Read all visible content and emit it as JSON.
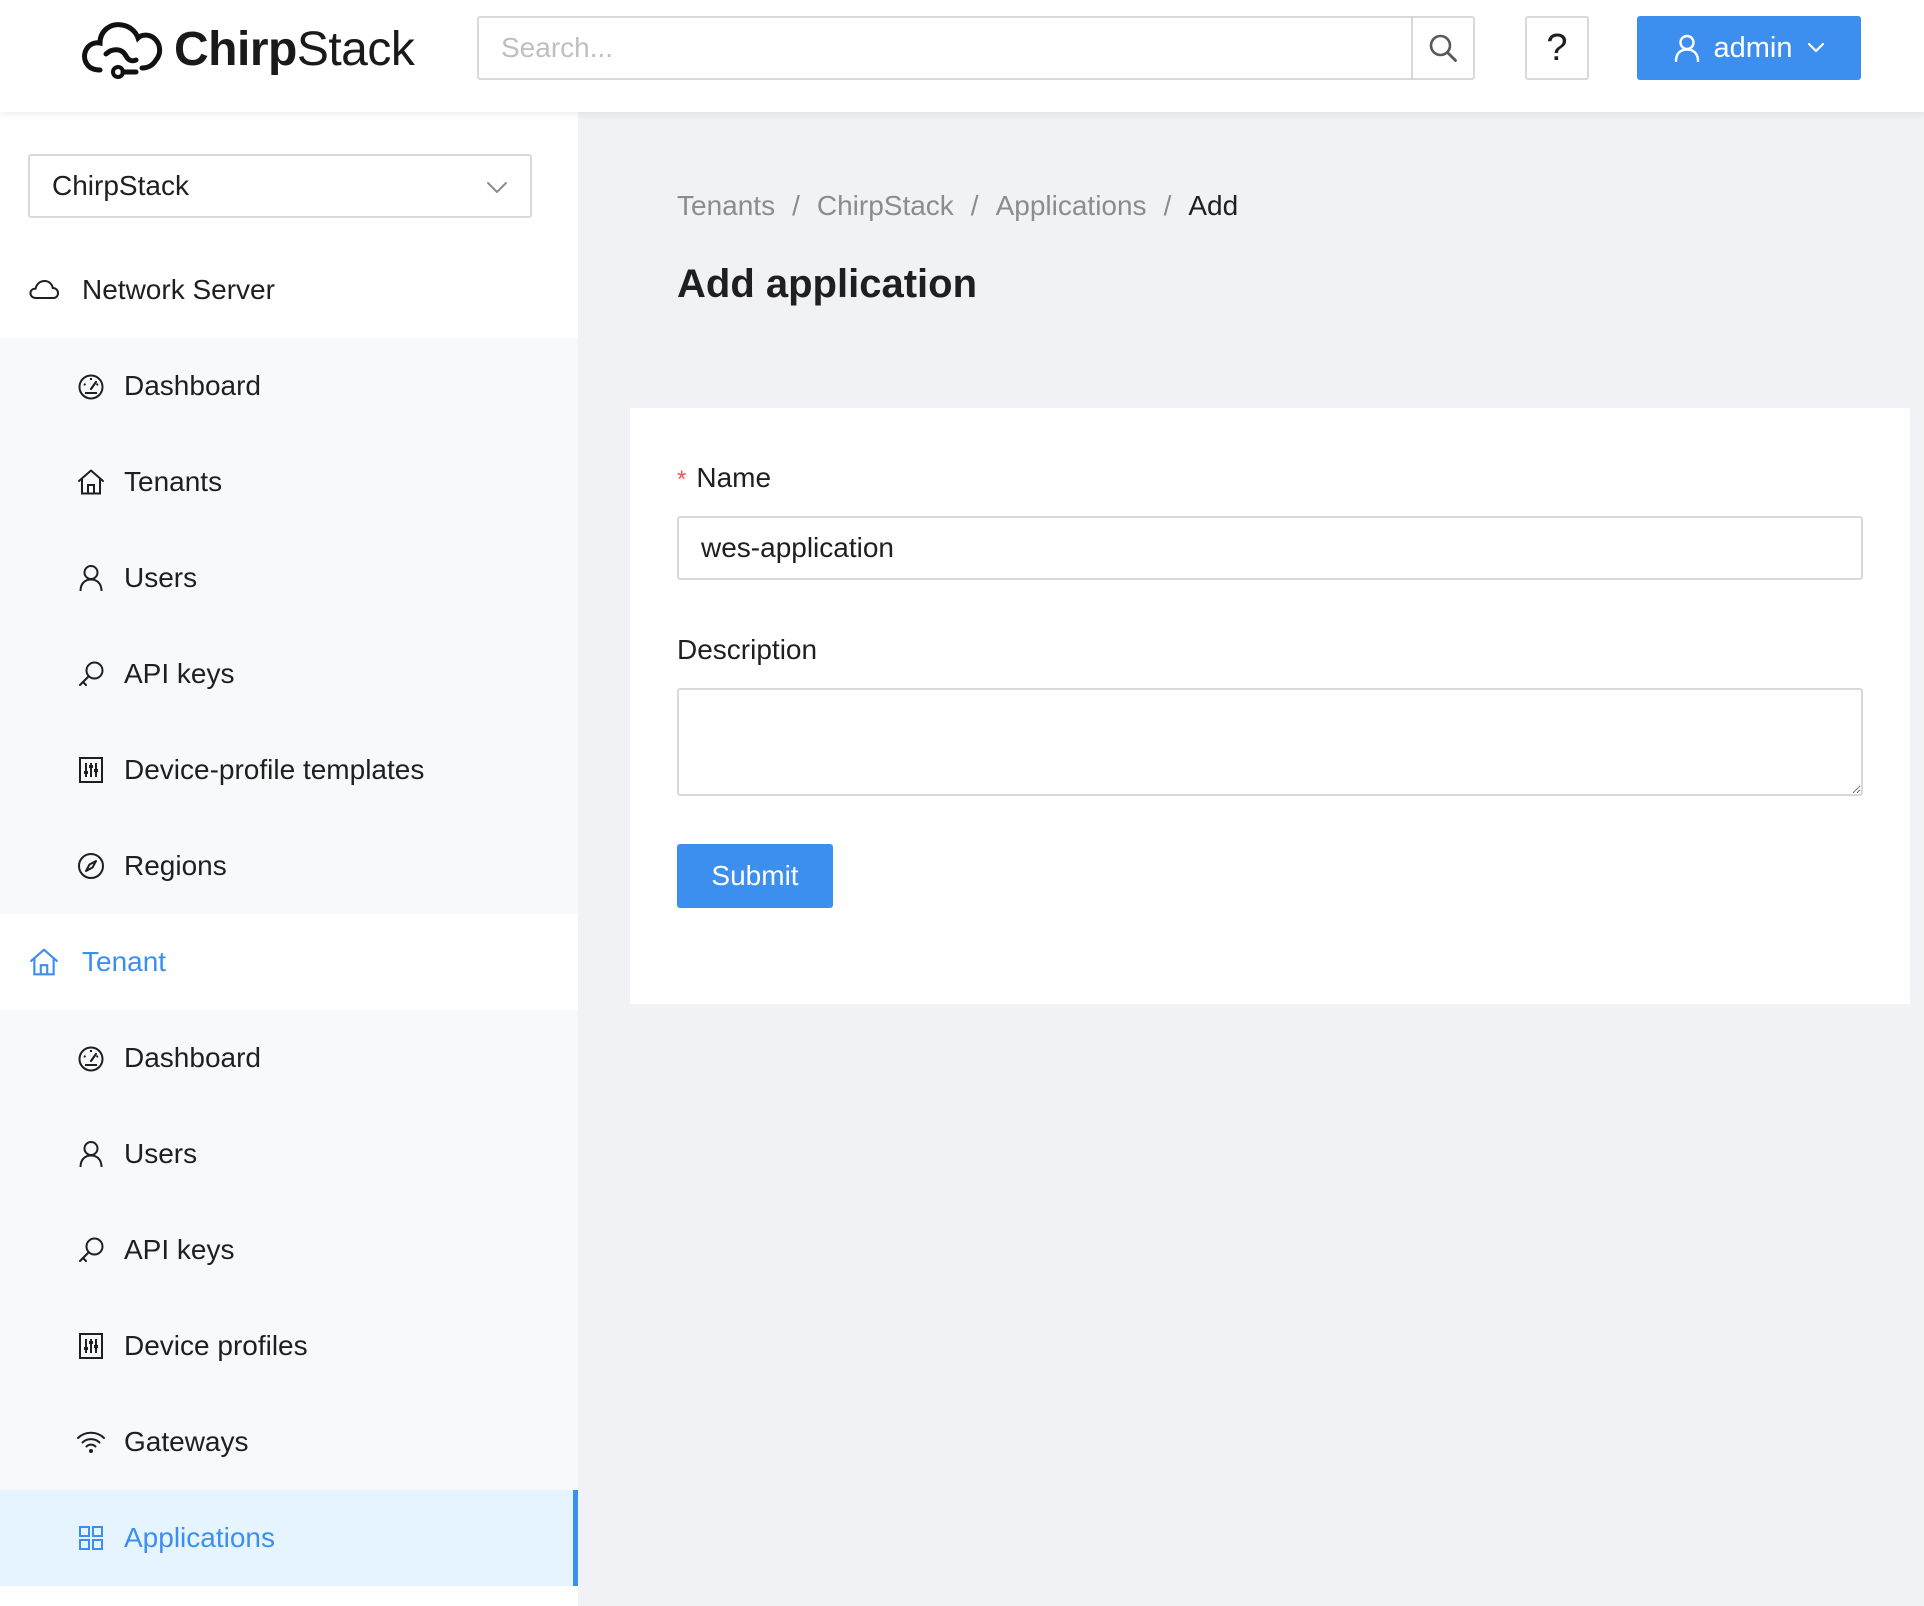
{
  "header": {
    "logo_text_bold": "Chirp",
    "logo_text_rest": "Stack",
    "search_placeholder": "Search...",
    "help_label": "?",
    "user_label": "admin"
  },
  "sidebar": {
    "tenant_select_value": "ChirpStack",
    "groups": [
      {
        "title": "Network Server",
        "icon": "cloud-icon",
        "items": [
          {
            "label": "Dashboard",
            "icon": "dashboard-icon"
          },
          {
            "label": "Tenants",
            "icon": "home-icon"
          },
          {
            "label": "Users",
            "icon": "user-icon"
          },
          {
            "label": "API keys",
            "icon": "key-icon"
          },
          {
            "label": "Device-profile templates",
            "icon": "control-icon"
          },
          {
            "label": "Regions",
            "icon": "compass-icon"
          }
        ]
      },
      {
        "title": "Tenant",
        "icon": "home-icon",
        "items": [
          {
            "label": "Dashboard",
            "icon": "dashboard-icon"
          },
          {
            "label": "Users",
            "icon": "user-icon"
          },
          {
            "label": "API keys",
            "icon": "key-icon"
          },
          {
            "label": "Device profiles",
            "icon": "control-icon"
          },
          {
            "label": "Gateways",
            "icon": "wifi-icon"
          },
          {
            "label": "Applications",
            "icon": "appstore-icon"
          }
        ]
      }
    ]
  },
  "breadcrumb": [
    "Tenants",
    "ChirpStack",
    "Applications",
    "Add"
  ],
  "page_title": "Add application",
  "form": {
    "name_label": "Name",
    "name_required_mark": "*",
    "name_value": "wes-application",
    "description_label": "Description",
    "description_value": "",
    "submit_label": "Submit"
  },
  "colors": {
    "accent": "#3c8fef",
    "required": "#ff4d4f",
    "background": "#f0f2f5"
  }
}
